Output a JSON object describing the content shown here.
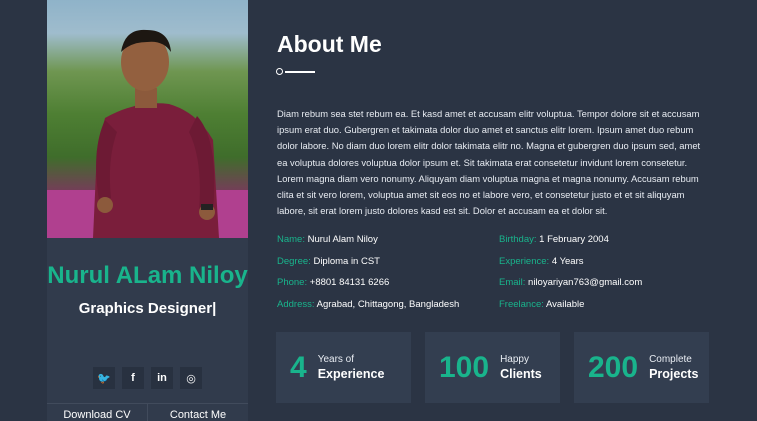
{
  "profile": {
    "name": "Nurul ALam Niloy",
    "role": "Graphics Designer|",
    "socials": [
      {
        "icon": "twitter-icon",
        "glyph": "🐦"
      },
      {
        "icon": "facebook-icon",
        "glyph": "f"
      },
      {
        "icon": "linkedin-icon",
        "glyph": "in"
      },
      {
        "icon": "instagram-icon",
        "glyph": "◎"
      }
    ],
    "download_label": "Download CV",
    "contact_label": "Contact Me"
  },
  "about": {
    "title": "About Me",
    "bio": "Diam rebum sea stet rebum ea. Et kasd amet et accusam elitr voluptua. Tempor dolore sit et accusam ipsum erat duo. Gubergren et takimata dolor duo amet et sanctus elitr lorem. Ipsum amet duo rebum dolor labore. No diam duo lorem elitr dolor takimata elitr no. Magna et gubergren duo ipsum sed, amet ea voluptua dolores voluptua dolor ipsum et. Sit takimata erat consetetur invidunt lorem consetetur. Lorem magna diam vero nonumy. Aliquyam diam voluptua magna et magna nonumy. Accusam rebum clita et sit vero lorem, voluptua amet sit eos no et labore vero, et consetetur justo et et sit aliquyam labore, sit erat lorem justo dolores kasd est sit. Dolor et accusam ea et dolor sit.",
    "info": [
      {
        "label": "Name:",
        "value": "Nurul Alam Niloy"
      },
      {
        "label": "Birthday:",
        "value": "1 February 2004"
      },
      {
        "label": "Degree:",
        "value": "Diploma in CST"
      },
      {
        "label": "Experience:",
        "value": "4 Years"
      },
      {
        "label": "Phone:",
        "value": "+8801 84131 6266"
      },
      {
        "label": "Email:",
        "value": "niloyariyan763@gmail.com"
      },
      {
        "label": "Address:",
        "value": "Agrabad, Chittagong, Bangladesh"
      },
      {
        "label": "Freelance:",
        "value": "Available"
      }
    ]
  },
  "stats": [
    {
      "number": "4",
      "small": "Years of",
      "big": "Experience"
    },
    {
      "number": "100",
      "small": "Happy",
      "big": "Clients"
    },
    {
      "number": "200",
      "small": "Complete",
      "big": "Projects"
    }
  ],
  "colors": {
    "accent": "#19b48c",
    "background": "#2b3444",
    "card": "#313b4c"
  }
}
